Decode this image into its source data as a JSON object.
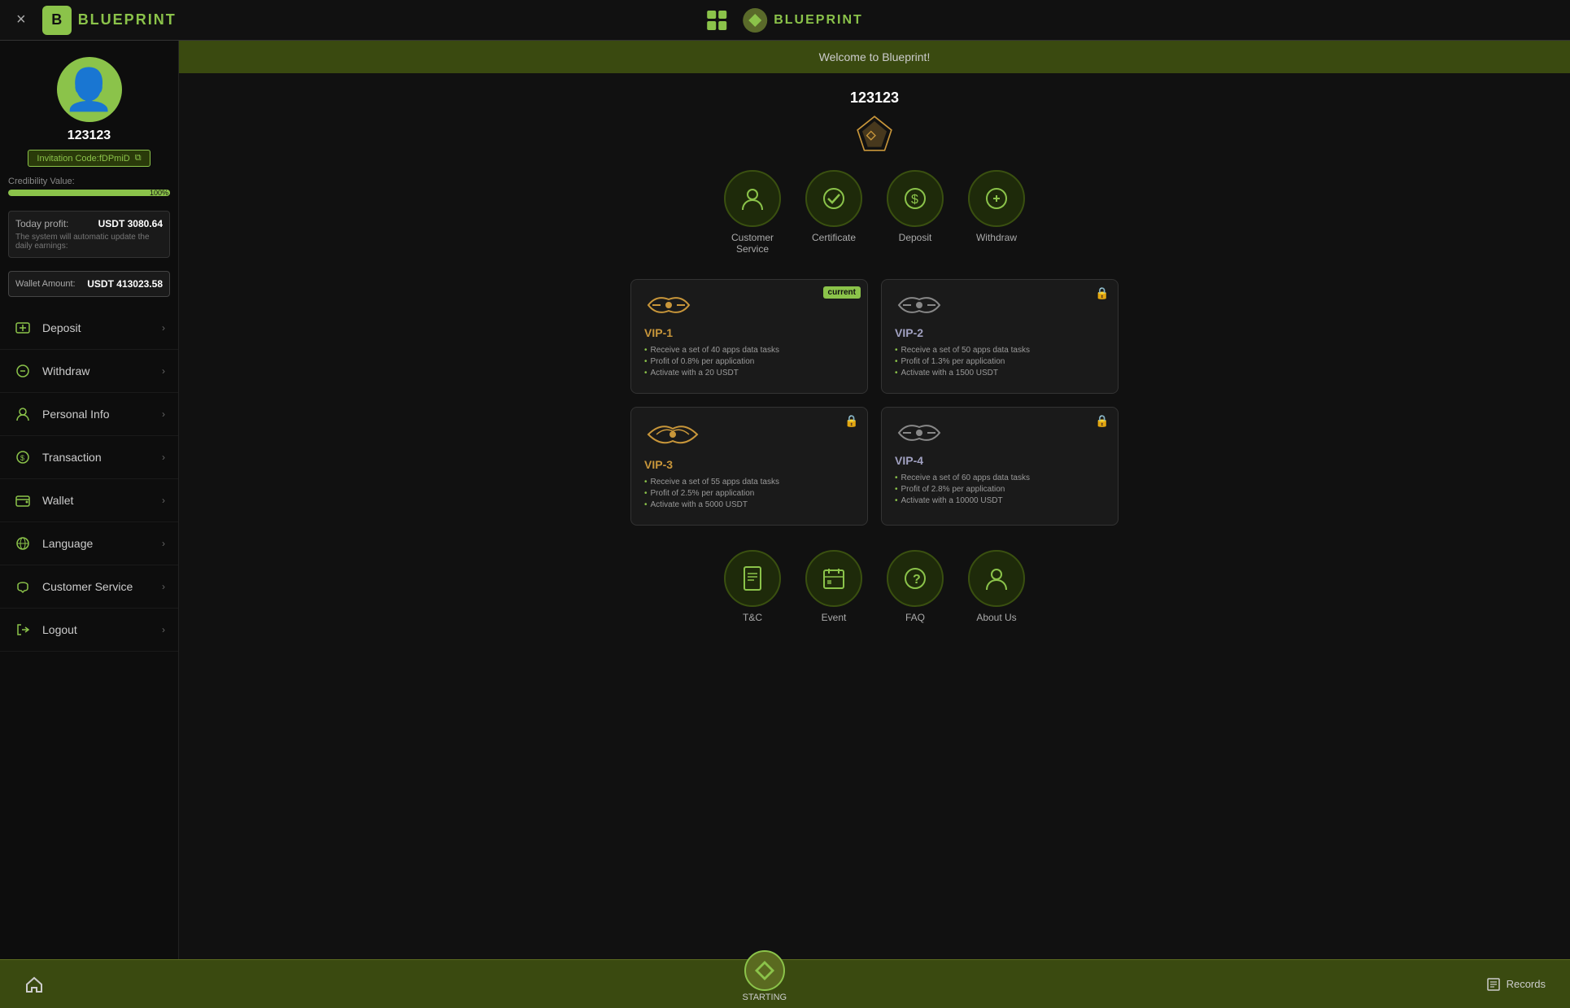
{
  "header": {
    "close_label": "×",
    "logo_letter": "B",
    "logo_text": "BLUEPRINT",
    "logo2_text": "BLUEPRINT"
  },
  "sidebar": {
    "username": "123123",
    "invitation_code": "Invitation Code:fDPmiD",
    "credibility_label": "Credibility Value:",
    "credibility_pct": "100%",
    "credibility_fill": 100,
    "profit_label": "Today profit:",
    "profit_value": "USDT 3080.64",
    "profit_desc": "The system will automatic update the daily earnings:",
    "wallet_label": "Wallet Amount:",
    "wallet_value": "USDT 413023.58",
    "menu": [
      {
        "label": "Deposit",
        "icon": "deposit-icon"
      },
      {
        "label": "Withdraw",
        "icon": "withdraw-icon"
      },
      {
        "label": "Personal Info",
        "icon": "person-icon"
      },
      {
        "label": "Transaction",
        "icon": "transaction-icon"
      },
      {
        "label": "Wallet",
        "icon": "wallet-icon"
      },
      {
        "label": "Language",
        "icon": "language-icon"
      },
      {
        "label": "Customer Service",
        "icon": "service-icon"
      },
      {
        "label": "Logout",
        "icon": "logout-icon"
      }
    ]
  },
  "welcome": "Welcome to Blueprint!",
  "main": {
    "username": "123123",
    "vip_icons": [
      {
        "label": "Customer\nService",
        "icon": "👤"
      },
      {
        "label": "Certificate",
        "icon": "✅"
      },
      {
        "label": "Deposit",
        "icon": "💲"
      },
      {
        "label": "Withdraw",
        "icon": "💰"
      }
    ],
    "vip_cards": [
      {
        "name": "VIP-1",
        "current": true,
        "locked": false,
        "features": [
          "Receive a set of 40 apps data tasks",
          "Profit of 0.8% per application",
          "Activate with a 20 USDT"
        ]
      },
      {
        "name": "VIP-2",
        "current": false,
        "locked": true,
        "features": [
          "Receive a set of 50 apps data tasks",
          "Profit of 1.3% per application",
          "Activate with a 1500 USDT"
        ]
      },
      {
        "name": "VIP-3",
        "current": false,
        "locked": true,
        "features": [
          "Receive a set of 55 apps data tasks",
          "Profit of 2.5% per application",
          "Activate with a 5000 USDT"
        ]
      },
      {
        "name": "VIP-4",
        "current": false,
        "locked": true,
        "features": [
          "Receive a set of 60 apps data tasks",
          "Profit of 2.8% per application",
          "Activate with a 10000 USDT"
        ]
      }
    ],
    "bottom_icons": [
      {
        "label": "T&C",
        "icon": "📄"
      },
      {
        "label": "Event",
        "icon": "📅"
      },
      {
        "label": "FAQ",
        "icon": "❓"
      },
      {
        "label": "About Us",
        "icon": "👤"
      }
    ]
  },
  "bottom_bar": {
    "starting_label": "STARTING",
    "records_label": "Records"
  }
}
